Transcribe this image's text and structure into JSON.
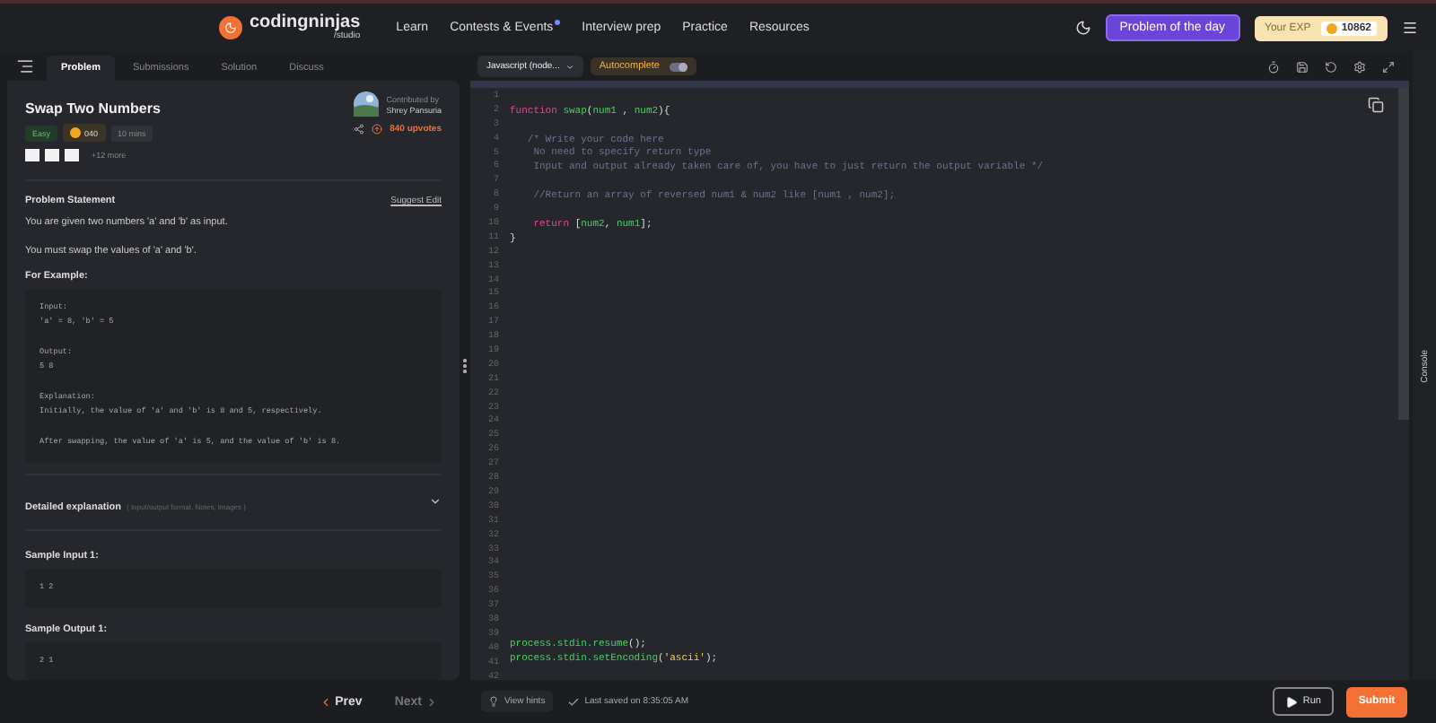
{
  "nav": {
    "logo": "codingninjas",
    "logo_sub": "/studio",
    "links": [
      {
        "label": "Learn",
        "dot": false
      },
      {
        "label": "Contests & Events",
        "dot": true
      },
      {
        "label": "Interview prep",
        "dot": false
      },
      {
        "label": "Practice",
        "dot": false
      },
      {
        "label": "Resources",
        "dot": false
      }
    ],
    "potd": "Problem of the day",
    "exp_label": "Your EXP",
    "exp_value": "10862"
  },
  "tabs": [
    {
      "label": "Problem",
      "selected": true
    },
    {
      "label": "Submissions",
      "selected": false
    },
    {
      "label": "Solution",
      "selected": false
    },
    {
      "label": "Discuss",
      "selected": false
    }
  ],
  "problem": {
    "title": "Swap Two Numbers",
    "difficulty": "Easy",
    "points": "040",
    "time": "10 mins",
    "company_tags": [
      {
        "kind": "chip"
      },
      {
        "kind": "chip"
      },
      {
        "kind": "chip"
      }
    ],
    "more_tags": "+12 more",
    "contributed_label": "Contributed by",
    "contributor": "Shrey Pansuria",
    "upvotes": "840 upvotes",
    "statement_heading": "Problem Statement",
    "suggest_edit": "Suggest Edit",
    "paragraphs": [
      "You are given two numbers 'a' and 'b' as input.",
      "You must swap the values of 'a' and 'b'."
    ],
    "example_heading": "For Example:",
    "example_blocks": [
      [
        "Input:",
        "'a' = 8, 'b' = 5"
      ],
      [
        "Output:",
        "5 8"
      ],
      [
        "Explanation:",
        "Initially, the value of 'a' and 'b' is 8 and 5, respectively."
      ],
      [
        "After swapping, the value of 'a' is 5, and the value of 'b' is 8."
      ]
    ],
    "detail_heading": "Detailed explanation",
    "detail_hint": "( Input/output format, Notes, Images )",
    "detail_expanded": false,
    "samples": [
      {
        "heading": "Sample Input 1:",
        "value": "1 2"
      },
      {
        "heading": "Sample Output 1:",
        "value": "2 1"
      }
    ]
  },
  "editor": {
    "language": "Javascript (node...",
    "autocomplete": "Autocomplete",
    "autocomplete_on": true,
    "lines": [
      {
        "number": "1"
      },
      {
        "number": "2",
        "tokens": [
          {
            "kind": "kw",
            "text": "function"
          },
          {
            "kind": "fn",
            "text": " swap"
          },
          {
            "kind": "plain",
            "text": "("
          },
          {
            "kind": "fn",
            "text": "num1"
          },
          {
            "kind": "plain",
            "text": " , "
          },
          {
            "kind": "fn",
            "text": "num2"
          },
          {
            "kind": "plain",
            "text": "){"
          }
        ]
      },
      {
        "number": "3"
      },
      {
        "number": "4",
        "tokens": [
          {
            "kind": "comment",
            "text": "   /* Write your code here"
          }
        ]
      },
      {
        "number": "5",
        "tokens": [
          {
            "kind": "comment",
            "text": "    No need to specify return type"
          }
        ]
      },
      {
        "number": "6",
        "tokens": [
          {
            "kind": "comment",
            "text": "    Input and output already taken care of, you have to just return the output variable */"
          }
        ]
      },
      {
        "number": "7"
      },
      {
        "number": "8",
        "tokens": [
          {
            "kind": "comment",
            "text": "    //Return an array of reversed num1 & num2 like [num1 , num2];"
          }
        ]
      },
      {
        "number": "9"
      },
      {
        "number": "10",
        "tokens": [
          {
            "kind": "kw",
            "text": "    return"
          },
          {
            "kind": "plain",
            "text": " ["
          },
          {
            "kind": "fn",
            "text": "num2"
          },
          {
            "kind": "plain",
            "text": ", "
          },
          {
            "kind": "fn",
            "text": "num1"
          },
          {
            "kind": "plain",
            "text": "];"
          }
        ]
      },
      {
        "number": "11",
        "tokens": [
          {
            "kind": "plain",
            "text": "}"
          }
        ]
      },
      {
        "number": "12"
      },
      {
        "number": "13"
      },
      {
        "number": "14"
      },
      {
        "number": "15"
      },
      {
        "number": "16"
      },
      {
        "number": "17"
      },
      {
        "number": "18"
      },
      {
        "number": "19"
      },
      {
        "number": "20"
      },
      {
        "number": "21"
      },
      {
        "number": "22"
      },
      {
        "number": "23"
      },
      {
        "number": "24"
      },
      {
        "number": "25"
      },
      {
        "number": "26"
      },
      {
        "number": "27"
      },
      {
        "number": "28"
      },
      {
        "number": "29"
      },
      {
        "number": "30"
      },
      {
        "number": "31"
      },
      {
        "number": "32"
      },
      {
        "number": "33"
      },
      {
        "number": "34"
      },
      {
        "number": "35"
      },
      {
        "number": "36"
      },
      {
        "number": "37"
      },
      {
        "number": "38"
      },
      {
        "number": "39"
      },
      {
        "number": "40",
        "tokens": [
          {
            "kind": "fn",
            "text": "process.stdin.resume"
          },
          {
            "kind": "plain",
            "text": "();"
          }
        ]
      },
      {
        "number": "41",
        "tokens": [
          {
            "kind": "fn",
            "text": "process.stdin.setEncoding"
          },
          {
            "kind": "plain",
            "text": "("
          },
          {
            "kind": "str",
            "text": "'ascii'"
          },
          {
            "kind": "plain",
            "text": ");"
          }
        ]
      },
      {
        "number": "42"
      }
    ]
  },
  "console": "Console",
  "footer": {
    "prev": "Prev",
    "next": "Next",
    "next_disabled": true,
    "hints": "View hints",
    "saved": "Last saved on 8:35:05 AM",
    "run": "Run",
    "submit": "Submit"
  }
}
